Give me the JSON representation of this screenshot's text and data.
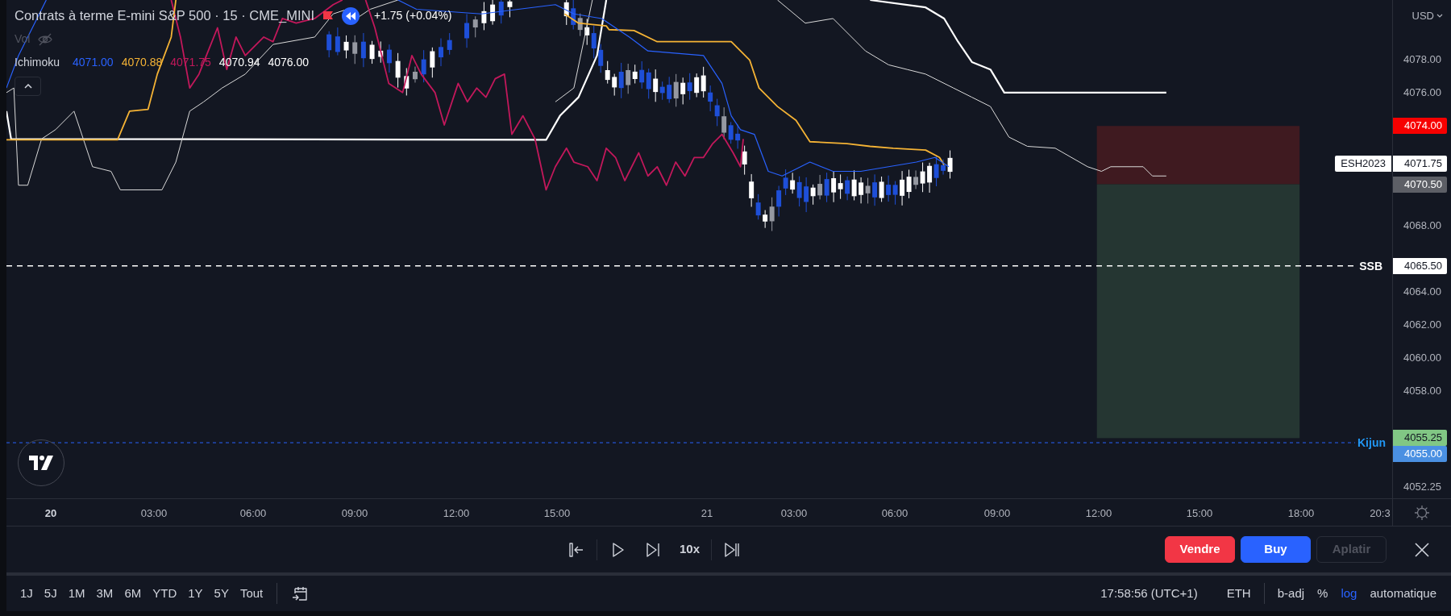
{
  "legend": {
    "title": "Contrats à terme E-mini S&P 500 · 15 · CME_MINI",
    "change": "+1.75 (+0.04%)",
    "volume": {
      "label": "Vol",
      "hidden": true
    },
    "indicator": {
      "name": "Ichimoku",
      "values": [
        {
          "text": "4071.00",
          "color": "#2962ff"
        },
        {
          "text": "4070.88",
          "color": "#f5b335"
        },
        {
          "text": "4071.75",
          "color": "#c2185b"
        },
        {
          "text": "4070.94",
          "color": "#ffffff"
        },
        {
          "text": "4076.00",
          "color": "#ffffff"
        }
      ]
    }
  },
  "symbol_tag": "ESH2023",
  "line_labels": [
    {
      "text": "SSB",
      "color": "#ffffff"
    },
    {
      "text": "Kijun",
      "color": "#2196f3"
    }
  ],
  "price_axis": {
    "currency": "USD",
    "labels": [
      {
        "text": "4078.00",
        "kind": "tick"
      },
      {
        "text": "4076.00",
        "kind": "tick"
      },
      {
        "text": "4074.00",
        "kind": "badge",
        "color": "#f70000"
      },
      {
        "text": "4071.75",
        "kind": "badge",
        "color": "#ffffff"
      },
      {
        "text": "4070.50",
        "kind": "badge",
        "color": "#5d5f66"
      },
      {
        "text": "4068.00",
        "kind": "tick"
      },
      {
        "text": "4065.50",
        "kind": "badge",
        "color": "#ffffff"
      },
      {
        "text": "4064.00",
        "kind": "tick"
      },
      {
        "text": "4062.00",
        "kind": "tick"
      },
      {
        "text": "4060.00",
        "kind": "tick"
      },
      {
        "text": "4058.00",
        "kind": "tick"
      },
      {
        "text": "4055.25",
        "kind": "badge",
        "color": "#81c784"
      },
      {
        "text": "4055.00",
        "kind": "badge",
        "color": "#4a90e2"
      },
      {
        "text": "4052.25",
        "kind": "tick"
      }
    ]
  },
  "time_axis": {
    "labels": [
      {
        "text": "20",
        "bold": true
      },
      {
        "text": "03:00",
        "bold": false
      },
      {
        "text": "06:00",
        "bold": false
      },
      {
        "text": "09:00",
        "bold": false
      },
      {
        "text": "12:00",
        "bold": false
      },
      {
        "text": "15:00",
        "bold": false
      },
      {
        "text": "21",
        "bold": false
      },
      {
        "text": "03:00",
        "bold": false
      },
      {
        "text": "06:00",
        "bold": false
      },
      {
        "text": "09:00",
        "bold": false
      },
      {
        "text": "12:00",
        "bold": false
      },
      {
        "text": "15:00",
        "bold": false
      },
      {
        "text": "18:00",
        "bold": false
      },
      {
        "text": "20:3",
        "bold": false
      }
    ]
  },
  "replay": {
    "speed": "10x"
  },
  "trade_buttons": [
    {
      "label": "Vendre",
      "kind": "sell",
      "disabled": false
    },
    {
      "label": "Buy",
      "kind": "buy",
      "disabled": false
    },
    {
      "label": "Aplatir",
      "kind": "flatten",
      "disabled": true
    }
  ],
  "toolbar": {
    "ranges": [
      "1J",
      "5J",
      "1M",
      "3M",
      "6M",
      "YTD",
      "1Y",
      "5Y",
      "Tout"
    ],
    "clock": "17:58:56 (UTC+1)",
    "session": "ETH",
    "options": [
      {
        "label": "b-adj",
        "selected": false
      },
      {
        "label": "%",
        "selected": false
      },
      {
        "label": "log",
        "selected": true
      },
      {
        "label": "automatique",
        "selected": false
      }
    ]
  }
}
